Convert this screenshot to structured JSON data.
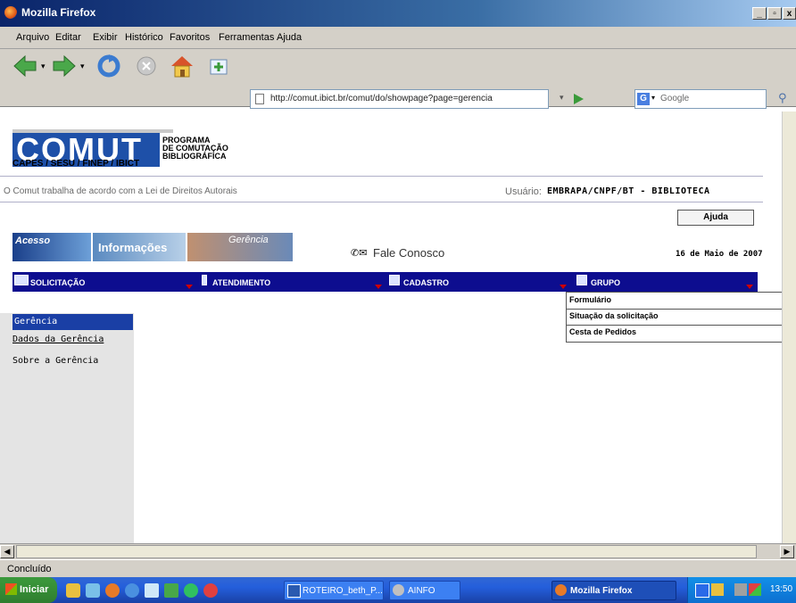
{
  "window": {
    "title": "Mozilla Firefox",
    "min": "_",
    "max": "▫",
    "close": "x"
  },
  "menu": [
    "Arquivo",
    "Editar",
    "Exibir",
    "Histórico",
    "Favoritos",
    "Ferramentas",
    "Ajuda"
  ],
  "url": "http://comut.ibict.br/comut/do/showpage?page=gerencia",
  "search_placeholder": "Google",
  "logo": {
    "text": "COMUT",
    "program": [
      "PROGRAMA",
      "DE COMUTAÇÃO",
      "BIBLIOGRÁFICA"
    ],
    "sub": "CAPES / SESU / FINEP / IBICT"
  },
  "notice": "O Comut trabalha de acordo com a Lei de Direitos Autorais",
  "user_label": "Usuário:",
  "user_value": "EMBRAPA/CNPF/BT - BIBLIOTECA",
  "help_button": "Ajuda",
  "image_tabs": [
    "Acesso",
    "Informações",
    "Gerência"
  ],
  "contact": "Fale Conosco",
  "date": "16 de Maio de 2007",
  "nav": [
    "SOLICITAÇÃO",
    "ATENDIMENTO",
    "CADASTRO",
    "GRUPO"
  ],
  "dropdown": [
    "Formulário",
    "Situação da solicitação",
    "Cesta de Pedidos"
  ],
  "sidebar": {
    "active": "Gerência",
    "items": [
      "Dados da Gerência",
      "Sobre a Gerência"
    ]
  },
  "status": "Concluído",
  "taskbar": {
    "start": "Iniciar",
    "buttons": [
      "ROTEIRO_beth_P...",
      "AINFO",
      "Mozilla Firefox"
    ],
    "clock": "13:50"
  }
}
